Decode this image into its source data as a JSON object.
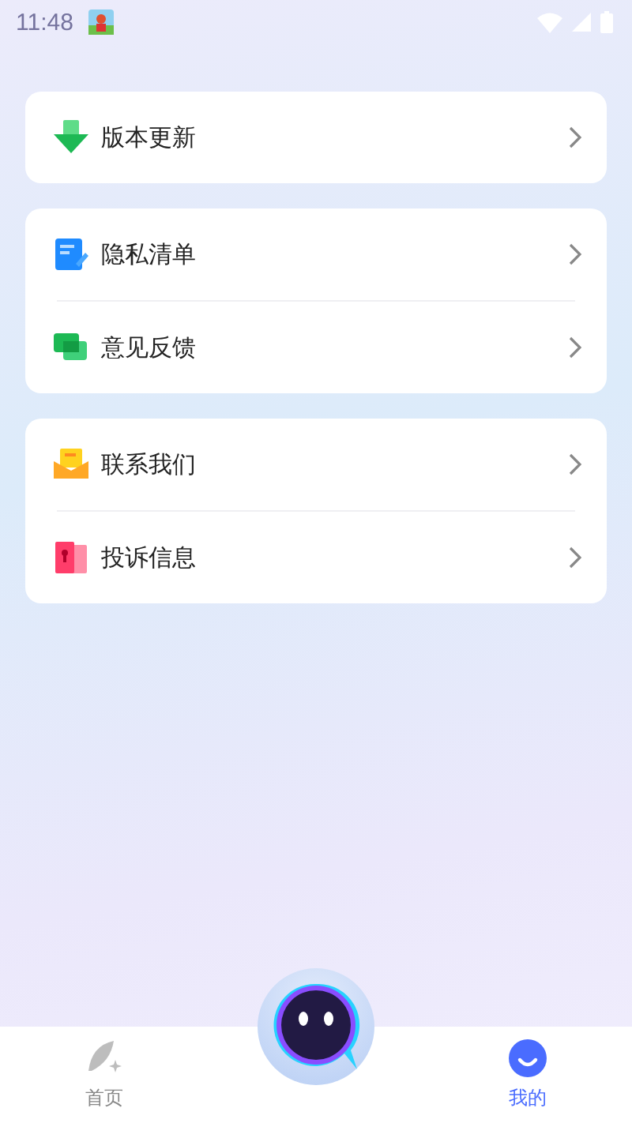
{
  "status_bar": {
    "time": "11:48"
  },
  "groups": [
    {
      "items": [
        {
          "kind": "download",
          "label": "版本更新"
        }
      ]
    },
    {
      "items": [
        {
          "kind": "note",
          "label": "隐私清单"
        },
        {
          "kind": "chat",
          "label": "意见反馈"
        }
      ]
    },
    {
      "items": [
        {
          "kind": "mail",
          "label": "联系我们"
        },
        {
          "kind": "complaint",
          "label": "投诉信息"
        }
      ]
    }
  ],
  "tabs": [
    {
      "kind": "home",
      "label": "首页",
      "selected": false
    },
    {
      "kind": "center"
    },
    {
      "kind": "mine",
      "label": "我的",
      "selected": true
    }
  ]
}
